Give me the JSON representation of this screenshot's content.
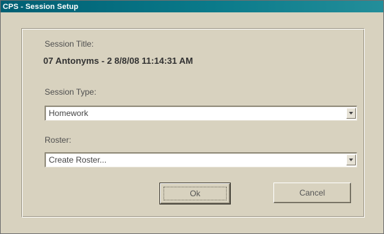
{
  "window": {
    "title": "CPS - Session Setup"
  },
  "session_title": {
    "label": "Session Title:",
    "value": "07 Antonyms - 2 8/8/08 11:14:31 AM"
  },
  "session_type": {
    "label": "Session Type:",
    "selected": "Homework"
  },
  "roster": {
    "label": "Roster:",
    "selected": "Create Roster..."
  },
  "buttons": {
    "ok_label": "Ok",
    "cancel_label": "Cancel"
  },
  "colors": {
    "titlebar": "#005f73",
    "dialog_background": "#d8d2bf"
  },
  "icons": {
    "dropdown": "chevron-down-icon"
  }
}
